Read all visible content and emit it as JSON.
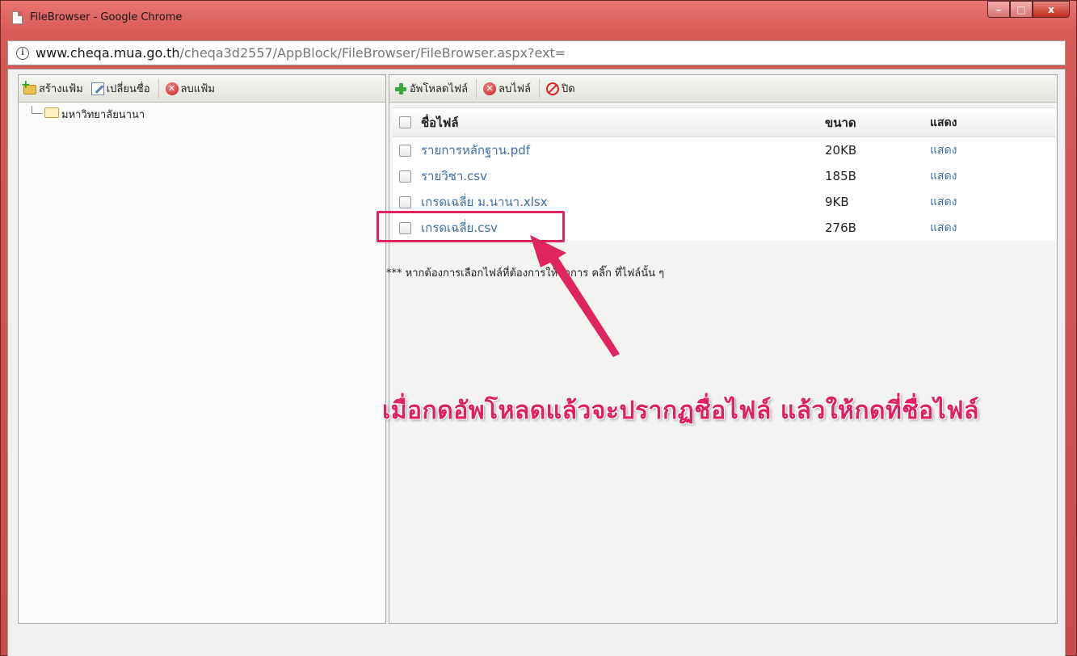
{
  "window": {
    "title": "FileBrowser - Google Chrome",
    "controls": {
      "minimize": "–",
      "maximize": "□",
      "close": "x"
    }
  },
  "address": {
    "info": "i",
    "host": "www.cheqa.mua.go.th",
    "path": "/cheqa3d2557/AppBlock/FileBrowser/FileBrowser.aspx?ext="
  },
  "left_toolbar": {
    "new_folder": "สร้างแฟ้ม",
    "rename": "เปลี่ยนชื่อ",
    "delete_folder": "ลบแฟ้ม"
  },
  "tree": {
    "root": "มหาวิทยาลัยนานา"
  },
  "right_toolbar": {
    "upload": "อัพโหลดไฟล์",
    "delete_file": "ลบไฟล์",
    "close": "ปิด"
  },
  "file_table": {
    "headers": {
      "name": "ชื่อไฟล์",
      "size": "ขนาด",
      "show": "แสดง"
    },
    "rows": [
      {
        "name": "รายการหลักฐาน.pdf",
        "size": "20KB",
        "show": "แสดง"
      },
      {
        "name": "รายวิชา.csv",
        "size": "185B",
        "show": "แสดง"
      },
      {
        "name": "เกรดเฉลี่ย ม.นานา.xlsx",
        "size": "9KB",
        "show": "แสดง"
      },
      {
        "name": "เกรดเฉลี่ย.csv",
        "size": "276B",
        "show": "แสดง"
      }
    ]
  },
  "note": "*** หากต้องการเลือกไฟล์ที่ต้องการให้ทำการ คลิ๊ก ที่ไฟล์นั้น ๆ",
  "annotation": {
    "text": "เมื่อกดอัพโหลดแล้วจะปรากฏชื่อไฟล์ แล้วให้กดที่ชื่อไฟล์",
    "color": "#e0245e"
  }
}
